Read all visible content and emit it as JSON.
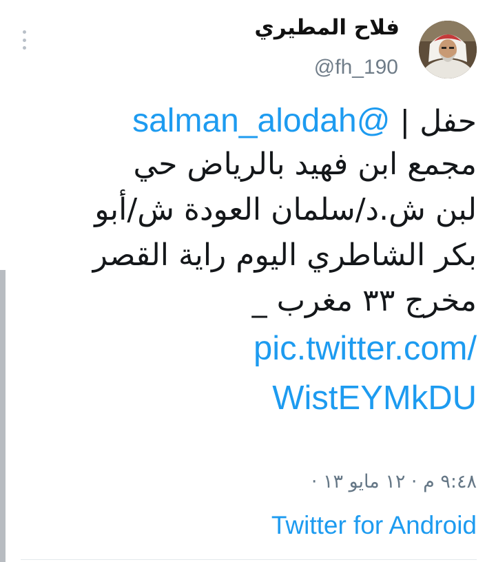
{
  "tweet": {
    "author": {
      "display_name": "فلاح المطيري",
      "handle": "@fh_190",
      "avatar_icon": "profile-photo"
    },
    "text_lines": {
      "line1_prefix": "حفل | ",
      "mention": "@salman_alodah",
      "line2": "مجمع ابن فهيد بالرياض حي",
      "line3": "لبن ش.د/سلمان العودة ش/أبو",
      "line4": "بكر الشاطري  اليوم راية القصر",
      "line5": "مخرج ٣٣ مغرب _"
    },
    "link": {
      "line1": "pic.twitter.com/",
      "line2": "WistEYMkDU"
    },
    "timestamp": "٩:٤٨ م · ١٢ مايو ١٣ ·",
    "source": "Twitter for Android",
    "more_icon": "vertical-ellipsis",
    "colors": {
      "link": "#1d9bf0",
      "muted": "#657786",
      "text": "#14171a"
    }
  }
}
